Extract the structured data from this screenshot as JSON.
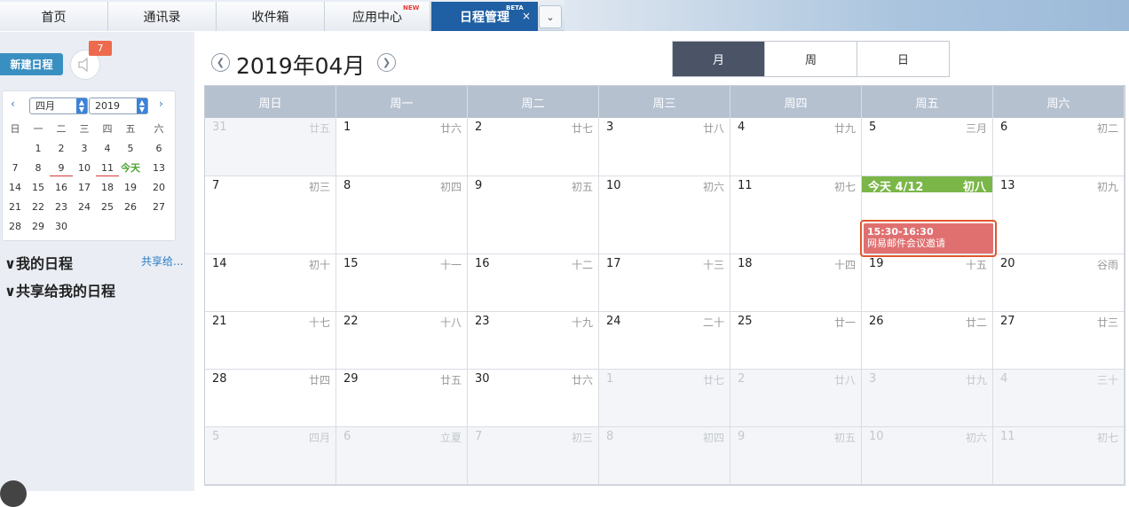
{
  "tabs": [
    {
      "label": "首页",
      "sup": ""
    },
    {
      "label": "通讯录",
      "sup": ""
    },
    {
      "label": "收件箱",
      "sup": ""
    },
    {
      "label": "应用中心",
      "sup": "NEW"
    },
    {
      "label": "日程管理",
      "sup": "BETA",
      "close": "×"
    }
  ],
  "tab_more": "⌄",
  "sidebar": {
    "new_event_label": "新建日程",
    "notification_count": "7",
    "mini_calendar": {
      "month": "四月",
      "year": "2019",
      "weekdays": [
        "日",
        "一",
        "二",
        "三",
        "四",
        "五",
        "六"
      ],
      "weeks": [
        [
          "",
          "1",
          "2",
          "3",
          "4",
          "5",
          "6"
        ],
        [
          "7",
          "8",
          "9",
          "10",
          "11",
          "今天",
          "13"
        ],
        [
          "14",
          "15",
          "16",
          "17",
          "18",
          "19",
          "20"
        ],
        [
          "21",
          "22",
          "23",
          "24",
          "25",
          "26",
          "27"
        ],
        [
          "28",
          "29",
          "30",
          "",
          "",
          "",
          ""
        ]
      ]
    },
    "my_calendar": "∨我的日程",
    "share_link": "共享给...",
    "shared_with_me": "∨共享给我的日程"
  },
  "header": {
    "month_title": "2019年04月",
    "views": [
      "月",
      "周",
      "日"
    ],
    "active_view": "月"
  },
  "weekday_headers": [
    "周日",
    "周一",
    "周二",
    "周三",
    "周四",
    "周五",
    "周六"
  ],
  "weeks": [
    [
      {
        "d": "31",
        "l": "廿五",
        "o": true
      },
      {
        "d": "1",
        "l": "廿六"
      },
      {
        "d": "2",
        "l": "廿七"
      },
      {
        "d": "3",
        "l": "廿八"
      },
      {
        "d": "4",
        "l": "廿九"
      },
      {
        "d": "5",
        "l": "三月"
      },
      {
        "d": "6",
        "l": "初二"
      }
    ],
    [
      {
        "d": "7",
        "l": "初三"
      },
      {
        "d": "8",
        "l": "初四"
      },
      {
        "d": "9",
        "l": "初五"
      },
      {
        "d": "10",
        "l": "初六"
      },
      {
        "d": "11",
        "l": "初七"
      },
      {
        "d": "今天 4/12",
        "l": "初八",
        "today": true
      },
      {
        "d": "13",
        "l": "初九"
      }
    ],
    [
      {
        "d": "14",
        "l": "初十"
      },
      {
        "d": "15",
        "l": "十一"
      },
      {
        "d": "16",
        "l": "十二"
      },
      {
        "d": "17",
        "l": "十三"
      },
      {
        "d": "18",
        "l": "十四"
      },
      {
        "d": "19",
        "l": "十五"
      },
      {
        "d": "20",
        "l": "谷雨"
      }
    ],
    [
      {
        "d": "21",
        "l": "十七"
      },
      {
        "d": "22",
        "l": "十八"
      },
      {
        "d": "23",
        "l": "十九"
      },
      {
        "d": "24",
        "l": "二十"
      },
      {
        "d": "25",
        "l": "廿一"
      },
      {
        "d": "26",
        "l": "廿二"
      },
      {
        "d": "27",
        "l": "廿三"
      }
    ],
    [
      {
        "d": "28",
        "l": "廿四"
      },
      {
        "d": "29",
        "l": "廿五"
      },
      {
        "d": "30",
        "l": "廿六"
      },
      {
        "d": "1",
        "l": "廿七",
        "o": true
      },
      {
        "d": "2",
        "l": "廿八",
        "o": true
      },
      {
        "d": "3",
        "l": "廿九",
        "o": true
      },
      {
        "d": "4",
        "l": "三十",
        "o": true
      }
    ],
    [
      {
        "d": "5",
        "l": "四月",
        "o": true
      },
      {
        "d": "6",
        "l": "立夏",
        "o": true
      },
      {
        "d": "7",
        "l": "初三",
        "o": true
      },
      {
        "d": "8",
        "l": "初四",
        "o": true
      },
      {
        "d": "9",
        "l": "初五",
        "o": true
      },
      {
        "d": "10",
        "l": "初六",
        "o": true
      },
      {
        "d": "11",
        "l": "初七",
        "o": true
      }
    ]
  ],
  "event": {
    "time": "15:30-16:30",
    "title": "网易邮件会议邀请",
    "color": "#e07070",
    "highlight": "#e2572d"
  },
  "colors": {
    "accent": "#1f5fa3",
    "today": "#7ab648",
    "new_button": "#3a8fc1"
  }
}
